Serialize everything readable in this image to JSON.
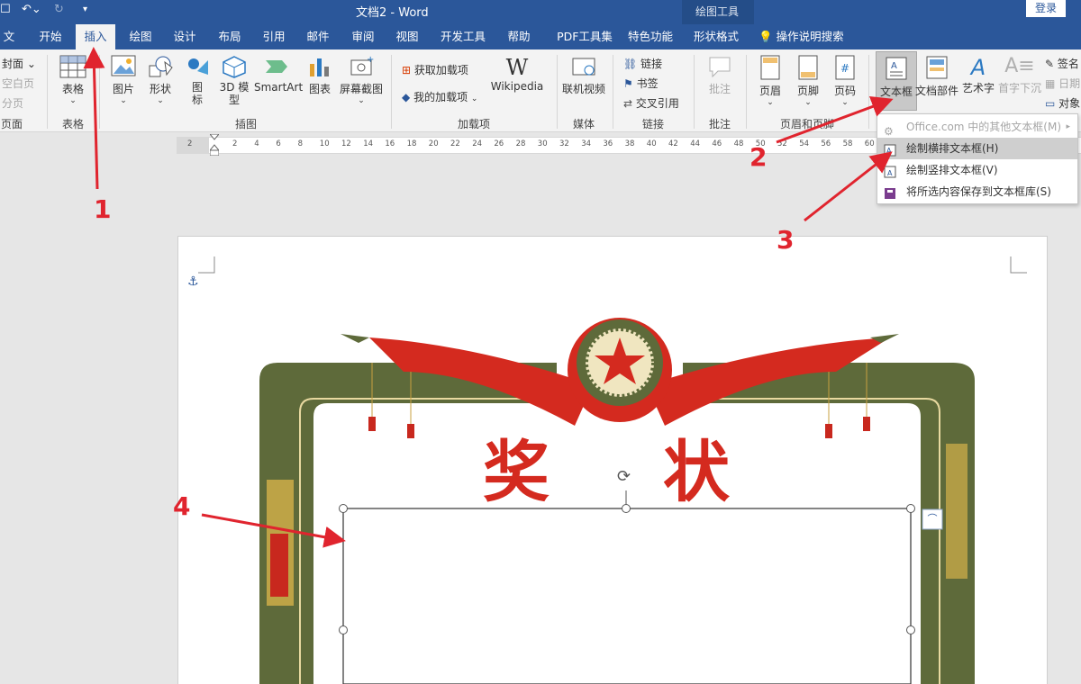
{
  "title_bar": {
    "doc_title": "文档2 - Word",
    "tool_context": "绘图工具",
    "login": "登录"
  },
  "tabs": [
    {
      "label": "文件"
    },
    {
      "label": "开始"
    },
    {
      "label": "插入"
    },
    {
      "label": "绘图"
    },
    {
      "label": "设计"
    },
    {
      "label": "布局"
    },
    {
      "label": "引用"
    },
    {
      "label": "邮件"
    },
    {
      "label": "审阅"
    },
    {
      "label": "视图"
    },
    {
      "label": "开发工具"
    },
    {
      "label": "帮助"
    },
    {
      "label": "PDF工具集"
    },
    {
      "label": "特色功能"
    },
    {
      "label": "形状格式"
    }
  ],
  "tell_me": "操作说明搜索",
  "ribbon": {
    "pages": {
      "cover": "封面",
      "blank": "空白页",
      "break": "分页",
      "group": "页面"
    },
    "table": {
      "label": "表格",
      "group": "表格"
    },
    "illustrations": {
      "picture": "图片",
      "shapes": "形状",
      "icons": "图标",
      "model3d": "3D 模型",
      "smartart": "SmartArt",
      "chart": "图表",
      "screenshot": "屏幕截图",
      "group": "插图"
    },
    "addins": {
      "get": "获取加载项",
      "my": "我的加载项",
      "wikipedia": "Wikipedia",
      "group": "加载项"
    },
    "media": {
      "video": "联机视频",
      "group": "媒体"
    },
    "links": {
      "link": "链接",
      "bookmark": "书签",
      "crossref": "交叉引用",
      "group": "链接"
    },
    "comments": {
      "comment": "批注",
      "group": "批注"
    },
    "header_footer": {
      "header": "页眉",
      "footer": "页脚",
      "page_number": "页码",
      "group": "页眉和页脚"
    },
    "text": {
      "textbox": "文本框",
      "quickparts": "文档部件",
      "wordart": "艺术字",
      "dropcap": "首字下沉",
      "signature": "签名",
      "date": "日期",
      "object": "对象"
    }
  },
  "ruler_ticks": [
    "2",
    "2",
    "4",
    "6",
    "8",
    "10",
    "12",
    "14",
    "16",
    "18",
    "20",
    "22",
    "24",
    "26",
    "28",
    "30",
    "32",
    "34",
    "36",
    "38",
    "40",
    "42",
    "44",
    "46",
    "48",
    "50",
    "52",
    "54",
    "56",
    "58",
    "60"
  ],
  "dropdown": {
    "items": [
      {
        "label": "Office.com 中的其他文本框(M)"
      },
      {
        "label": "绘制横排文本框(H)"
      },
      {
        "label": "绘制竖排文本框(V)"
      },
      {
        "label": "将所选内容保存到文本框库(S)"
      }
    ]
  },
  "certificate": {
    "title_left": "奖",
    "title_right": "状"
  },
  "annotations": [
    "1",
    "2",
    "3",
    "4"
  ],
  "colors": {
    "brand": "#2b579a",
    "ribbon_bg": "#f3f3f3",
    "annotation_red": "#e0242e",
    "frame_olive": "#5e6a3a",
    "banner_red": "#d42a1f"
  }
}
